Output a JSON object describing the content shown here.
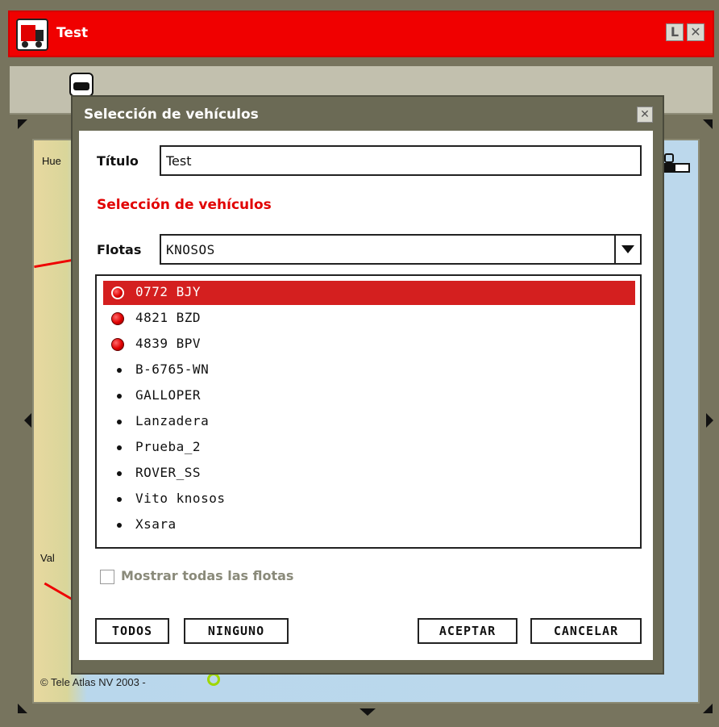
{
  "window": {
    "title": "Test",
    "min_glyph": "L",
    "close_glyph": "✕"
  },
  "map": {
    "label_top": "Hue",
    "label_mid": "Val",
    "copyright": "© Tele Atlas NV 2003 -"
  },
  "dialog": {
    "title": "Selección de vehículos",
    "close_glyph": "✕",
    "title_label": "Título",
    "title_value": "Test",
    "section_title": "Selección de vehículos",
    "fleet_label": "Flotas",
    "fleet_selected": "KNOSOS",
    "vehicles": [
      {
        "name": "0772 BJY",
        "icon": "red",
        "selected": true
      },
      {
        "name": "4821 BZD",
        "icon": "red",
        "selected": false
      },
      {
        "name": "4839 BPV",
        "icon": "red",
        "selected": false
      },
      {
        "name": "B-6765-WN",
        "icon": "dot",
        "selected": false
      },
      {
        "name": "GALLOPER",
        "icon": "dot",
        "selected": false
      },
      {
        "name": "Lanzadera",
        "icon": "dot",
        "selected": false
      },
      {
        "name": "Prueba_2",
        "icon": "dot",
        "selected": false
      },
      {
        "name": "ROVER_SS",
        "icon": "dot",
        "selected": false
      },
      {
        "name": "Vito knosos",
        "icon": "dot",
        "selected": false
      },
      {
        "name": "Xsara",
        "icon": "dot",
        "selected": false
      }
    ],
    "show_all_label": "Mostrar todas las flotas",
    "show_all_checked": false,
    "buttons": {
      "all": "TODOS",
      "none": "NINGUNO",
      "accept": "ACEPTAR",
      "cancel": "CANCELAR"
    }
  },
  "colors": {
    "titlebar": "#f00000",
    "selection": "#d41f1f",
    "section_title": "#e10000"
  }
}
